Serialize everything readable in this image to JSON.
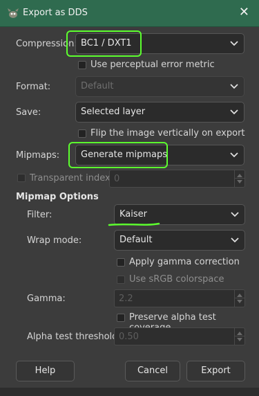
{
  "window": {
    "title": "Export as DDS",
    "icon": "gimp-icon",
    "close": "✕"
  },
  "compression": {
    "label": "Compression:",
    "value": "BC1 / DXT1"
  },
  "perceptual": {
    "label": "Use perceptual error metric",
    "checked": false
  },
  "format": {
    "label": "Format:",
    "value": "Default",
    "disabled": true
  },
  "save": {
    "label": "Save:",
    "value": "Selected layer"
  },
  "flip": {
    "label": "Flip the image vertically on export",
    "checked": false
  },
  "mipmaps": {
    "label": "Mipmaps:",
    "value": "Generate mipmaps"
  },
  "transparent": {
    "label": "Transparent index:",
    "value": "0",
    "checked": false,
    "disabled": true
  },
  "mipmap_options": {
    "title": "Mipmap Options",
    "filter": {
      "label": "Filter:",
      "value": "Kaiser"
    },
    "wrap": {
      "label": "Wrap mode:",
      "value": "Default"
    },
    "gamma_correction": {
      "label": "Apply gamma correction",
      "checked": false
    },
    "srgb": {
      "label": "Use sRGB colorspace",
      "checked": false,
      "disabled": true
    },
    "gamma": {
      "label": "Gamma:",
      "value": "2.2",
      "disabled": true
    },
    "alpha_coverage": {
      "label": "Preserve alpha test coverage",
      "checked": false
    },
    "alpha_threshold": {
      "label": "Alpha test threshold:",
      "value": "0.50",
      "disabled": true
    }
  },
  "buttons": {
    "help": "Help",
    "cancel": "Cancel",
    "export": "Export"
  },
  "colors": {
    "titlebar": "#2f6b4f",
    "background": "#3c3c3c",
    "annotation": "#5cff2e"
  }
}
